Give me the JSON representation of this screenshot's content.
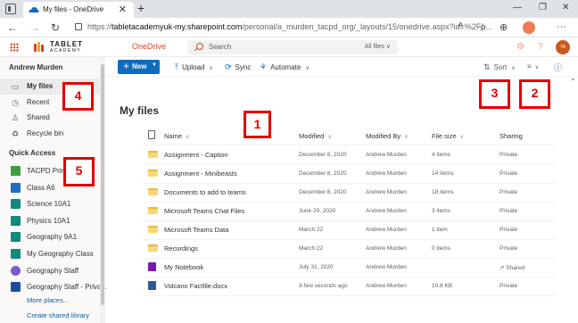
{
  "browser": {
    "tab_title": "My files - OneDrive",
    "tab_close": "✕",
    "new_tab": "+",
    "url_host": "tabletacademyuk-my.sharepoint.com",
    "url_prefix": "https://",
    "url_path": "/personal/a_murden_tacpd_org/_layouts/15/onedrive.aspx?id=%2Fp...",
    "nav": {
      "back": "←",
      "forward": "→",
      "reload": "↻"
    },
    "window": {
      "minimize": "—",
      "maximize": "❐",
      "close": "✕"
    },
    "toolbar_icons": [
      "read-aloud-icon",
      "favorites-icon",
      "collections-icon",
      "extensions-icon",
      "profile-icon",
      "more-icon"
    ],
    "more": "···"
  },
  "suite": {
    "logo_line1": "TABLET",
    "logo_line2": "ACADEMY",
    "app_name": "OneDrive",
    "search_placeholder": "Search",
    "search_scope": "All files ∨",
    "avatar_initials": "TA"
  },
  "sidebar": {
    "user_name": "Andrew Murden",
    "items": [
      {
        "label": "My files",
        "icon": "folder-icon",
        "glyph": "▭",
        "active": true
      },
      {
        "label": "Recent",
        "icon": "clock-icon",
        "glyph": "◷",
        "active": false
      },
      {
        "label": "Shared",
        "icon": "shared-icon",
        "glyph": "♙",
        "active": false
      },
      {
        "label": "Recycle bin",
        "icon": "recycle-bin-icon",
        "glyph": "♻",
        "active": false
      }
    ],
    "quick_access_heading": "Quick Access",
    "quick_access": [
      {
        "label": "TACPD Prima...",
        "color": "#3f9e3f"
      },
      {
        "label": "Class A6",
        "color": "#1b6ec2"
      },
      {
        "label": "Science 10A1",
        "color": "#0e8a7e"
      },
      {
        "label": "Physics 10A1",
        "color": "#0e8a7e"
      },
      {
        "label": "Geography 9A1",
        "color": "#0e8a7e"
      },
      {
        "label": "My Geography Class",
        "color": "#0e8a7e"
      },
      {
        "label": "Geography Staff",
        "color": "#7a5cc9"
      },
      {
        "label": "Geography Staff - Priva...",
        "color": "#1b4f9e"
      }
    ],
    "more_places": "More places...",
    "create_shared_library": "Create shared library"
  },
  "commandbar": {
    "new_label": "New",
    "upload_label": "Upload",
    "sync_label": "Sync",
    "automate_label": "Automate",
    "sort_label": "Sort",
    "view_label": "≡",
    "info_label": "ⓘ"
  },
  "main": {
    "title": "My files",
    "columns": {
      "name": "Name",
      "modified": "Modified",
      "modified_by": "Modified By",
      "file_size": "File size",
      "sharing": "Sharing"
    },
    "rows": [
      {
        "type": "folder",
        "name": "Assignment - Caption",
        "modified": "December 8, 2020",
        "modified_by": "Andrew Murden",
        "size": "4 items",
        "sharing": "Private"
      },
      {
        "type": "folder",
        "name": "Assignment - Minibeasts",
        "modified": "December 8, 2020",
        "modified_by": "Andrew Murden",
        "size": "14 items",
        "sharing": "Private"
      },
      {
        "type": "folder",
        "name": "Documents to add to teams",
        "modified": "December 8, 2020",
        "modified_by": "Andrew Murden",
        "size": "18 items",
        "sharing": "Private"
      },
      {
        "type": "folder",
        "name": "Microsoft Teams Chat Files",
        "modified": "June 29, 2020",
        "modified_by": "Andrew Murden",
        "size": "3 items",
        "sharing": "Private"
      },
      {
        "type": "folder",
        "name": "Microsoft Teams Data",
        "modified": "March 22",
        "modified_by": "Andrew Murden",
        "size": "1 item",
        "sharing": "Private"
      },
      {
        "type": "folder",
        "name": "Recordings",
        "modified": "March 22",
        "modified_by": "Andrew Murden",
        "size": "0 items",
        "sharing": "Private"
      },
      {
        "type": "onenote",
        "name": "My Notebook",
        "modified": "July 31, 2020",
        "modified_by": "Andrew Murden",
        "size": "",
        "sharing": "⇗ Shared"
      },
      {
        "type": "word",
        "name": "Volcano Factfile.docx",
        "modified": "A few seconds ago",
        "modified_by": "Andrew Murden",
        "size": "10.8 KB",
        "sharing": "Private"
      }
    ]
  },
  "annotations": [
    {
      "label": "1"
    },
    {
      "label": "2"
    },
    {
      "label": "3"
    },
    {
      "label": "4"
    },
    {
      "label": "5"
    }
  ],
  "colors": {
    "accent": "#0f6cbd",
    "brand": "#d24726",
    "annotation": "#e20000",
    "folder": "#f8d775"
  }
}
